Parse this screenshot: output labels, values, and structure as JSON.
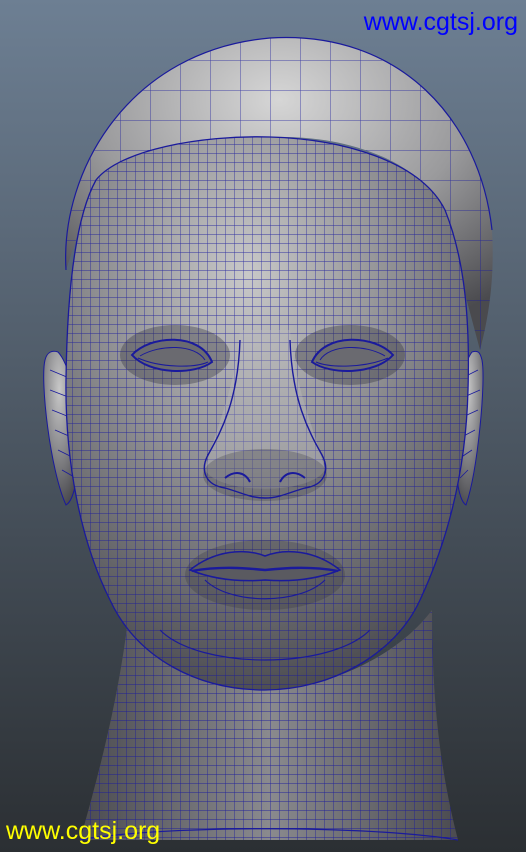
{
  "watermarks": {
    "top": "www.cgtsj.org",
    "bottom": "www.cgtsj.org"
  },
  "colors": {
    "background_top": "#6d7f93",
    "background_bottom": "#2b2f33",
    "mesh_shading_light": "#c2c2c2",
    "mesh_shading_dark": "#3d3d42",
    "wireframe": "#1a1a9c",
    "watermark_top": "#0000ff",
    "watermark_bottom": "#ffff00"
  },
  "scene": {
    "subject": "wireframe-head-model",
    "view": "front"
  }
}
